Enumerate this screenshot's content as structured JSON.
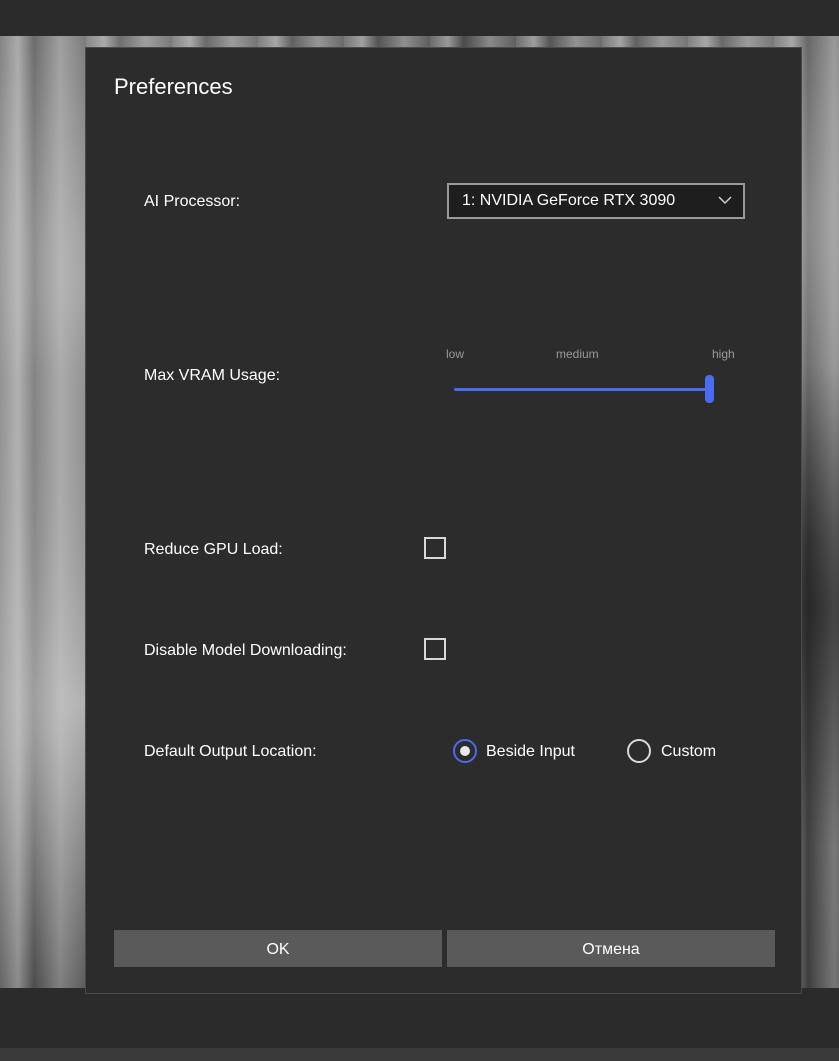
{
  "dialog": {
    "title": "Preferences",
    "ai_processor": {
      "label": "AI Processor:",
      "selected": "1: NVIDIA GeForce RTX 3090"
    },
    "vram": {
      "label": "Max VRAM Usage:",
      "ticks": [
        "low",
        "medium",
        "high"
      ],
      "value_fraction": 1.0
    },
    "reduce_gpu_load": {
      "label": "Reduce GPU Load:",
      "checked": false
    },
    "disable_model_downloading": {
      "label": "Disable Model Downloading:",
      "checked": false
    },
    "output_location": {
      "label": "Default Output Location:",
      "options": [
        "Beside Input",
        "Custom"
      ],
      "selected": "Beside Input"
    },
    "buttons": {
      "ok": "OK",
      "cancel": "Отмена"
    }
  },
  "colors": {
    "accent": "#4a6cf0",
    "dialog_bg": "#2c2c2c",
    "button_bg": "#5a5a5a"
  },
  "icons": {
    "dropdown": "chevron-down-icon"
  }
}
